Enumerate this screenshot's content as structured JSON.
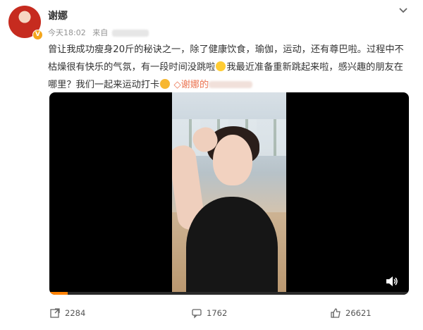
{
  "post": {
    "username": "谢娜",
    "time": "今天18:02",
    "source_prefix": "来自",
    "text_line1": "曾让我成功瘦身20斤的秘诀之一，除了健康饮食，瑜伽，运动，还有尊巴啦。过程中不",
    "text_line2": "枯燥很有快乐的气氛，有一段时间没跳啦",
    "text_line2b": "我最近准备重新跳起来啦，感兴趣的朋友在",
    "text_line3": "哪里？我们一起来运动打卡",
    "link_text": "谢娜的"
  },
  "video": {
    "progress": 0.05,
    "volume_icon": "speaker-icon"
  },
  "actions": {
    "repost_count": "2284",
    "comment_count": "1762",
    "like_count": "26621"
  },
  "icons": [
    "chevron-down-icon",
    "repost-icon",
    "comment-icon",
    "like-icon",
    "speaker-icon",
    "verified-badge"
  ]
}
